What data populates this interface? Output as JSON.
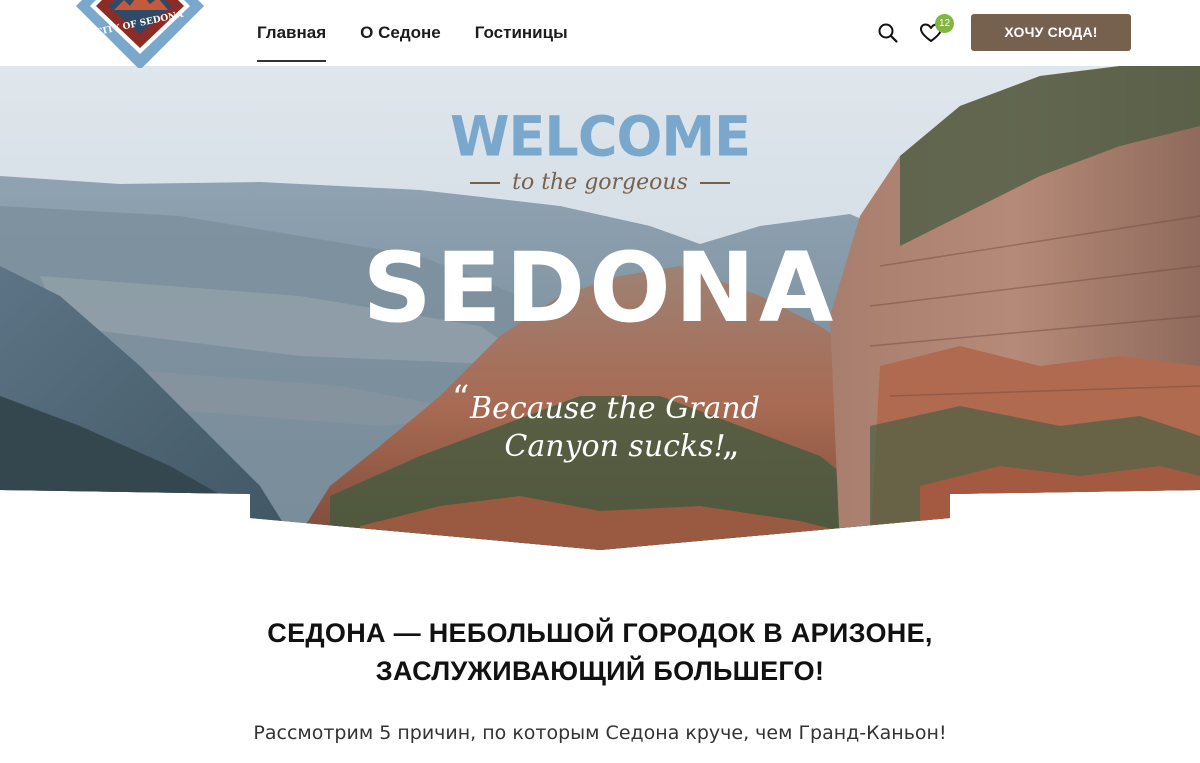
{
  "header": {
    "logo_text": "CITY OF SEDONA",
    "nav": [
      {
        "label": "Главная",
        "active": true
      },
      {
        "label": "О Седоне",
        "active": false
      },
      {
        "label": "Гостиницы",
        "active": false
      }
    ],
    "search_icon": "search-icon",
    "favorites_icon": "heart-icon",
    "favorites_count": "12",
    "cta_label": "ХОЧУ СЮДА!"
  },
  "hero": {
    "welcome": "WELCOME",
    "tagline": "to the gorgeous",
    "title": "SEDONA",
    "quote_line1": "Because the Grand",
    "quote_line2": "Canyon sucks!",
    "open_quote": "“",
    "close_quote": "„"
  },
  "content": {
    "title_line1": "СЕДОНА — НЕБОЛЬШОЙ ГОРОДОК В АРИЗОНЕ,",
    "title_line2": "ЗАСЛУЖИВАЮЩИЙ БОЛЬШЕГО!",
    "subtitle": "Рассмотрим 5 причин, по которым Седона круче, чем Гранд-Каньон!"
  },
  "colors": {
    "accent_brown": "#76614f",
    "welcome_blue": "#7aa7cc",
    "badge_green": "#82b641"
  }
}
